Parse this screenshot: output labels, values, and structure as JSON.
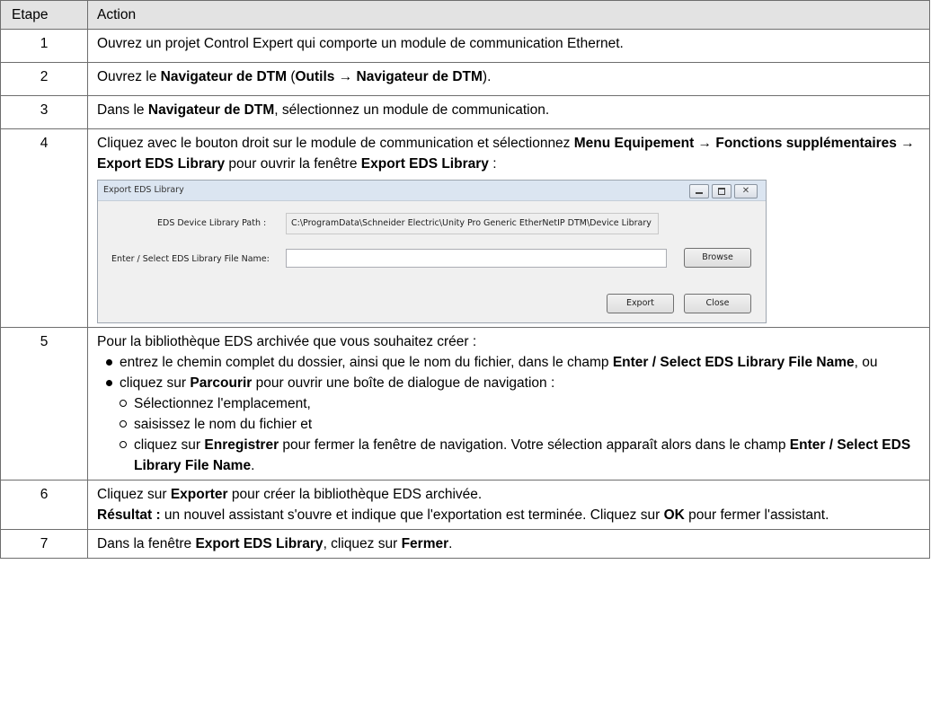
{
  "table": {
    "headers": {
      "step": "Etape",
      "action": "Action"
    }
  },
  "rows": [
    {
      "num": "1",
      "text": "Ouvrez un projet Control Expert qui comporte un module de communication Ethernet."
    },
    {
      "num": "2",
      "parts": [
        "Ouvrez le ",
        "Navigateur de DTM",
        " (",
        "Outils → Navigateur de DTM",
        ")."
      ]
    },
    {
      "num": "3",
      "parts": [
        "Dans le ",
        "Navigateur de DTM",
        ", sélectionnez un module de communication."
      ]
    },
    {
      "num": "4",
      "parts": [
        "Cliquez avec le bouton droit sur le module de communication et sélectionnez ",
        "Menu Equipement →",
        " ",
        "Fonctions supplémentaires → Export EDS Library",
        " pour ouvrir la fenêtre ",
        "Export EDS Library",
        " :"
      ]
    },
    {
      "num": "5",
      "intro": "Pour la bibliothèque EDS archivée que vous souhaitez créer :",
      "bullet1": [
        "entrez le chemin complet du dossier, ainsi que le nom du fichier, dans le champ ",
        "Enter / Select EDS Library File Name",
        ", ou"
      ],
      "bullet2": [
        "cliquez sur ",
        "Parcourir",
        " pour ouvrir une boîte de dialogue de navigation :"
      ],
      "sub1": "Sélectionnez l'emplacement,",
      "sub2": "saisissez le nom du fichier et",
      "sub3": [
        "cliquez sur ",
        "Enregistrer",
        " pour fermer la fenêtre de navigation. Votre sélection apparaît alors dans le champ ",
        "Enter / Select EDS Library File Name",
        "."
      ]
    },
    {
      "num": "6",
      "line1": [
        "Cliquez sur ",
        "Exporter",
        " pour créer la bibliothèque EDS archivée."
      ],
      "line2": [
        "Résultat :",
        " un nouvel assistant s'ouvre et indique que l'exportation est terminée. Cliquez sur ",
        "OK",
        " pour fermer l'assistant."
      ]
    },
    {
      "num": "7",
      "parts": [
        "Dans la fenêtre ",
        "Export EDS Library",
        ", cliquez sur ",
        "Fermer",
        "."
      ]
    }
  ],
  "dialog": {
    "title": "Export EDS Library",
    "path_label": "EDS Device Library Path :",
    "path_value": "C:\\ProgramData\\Schneider Electric\\Unity Pro Generic EtherNetIP DTM\\Device Library",
    "file_label": "Enter / Select EDS Library File Name:",
    "file_value": "",
    "browse": "Browse",
    "export": "Export",
    "close": "Close",
    "close_glyph": "✕"
  }
}
